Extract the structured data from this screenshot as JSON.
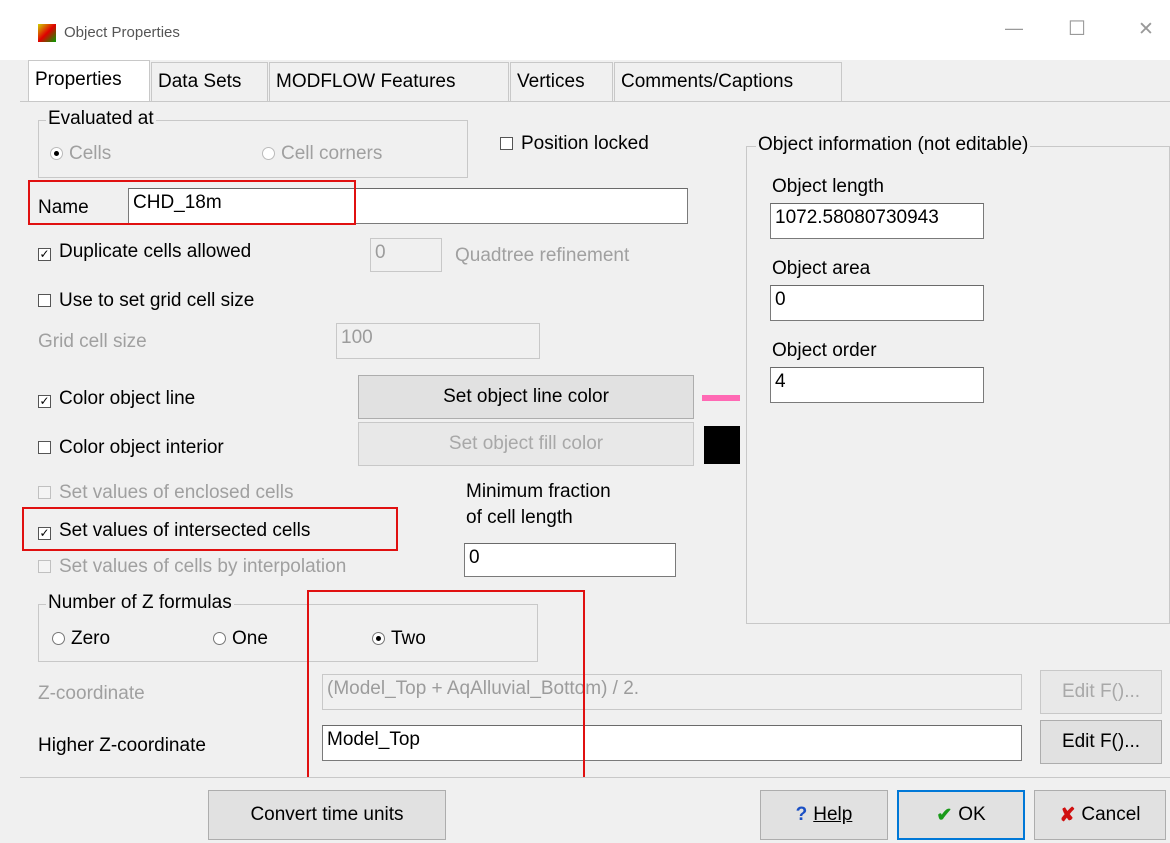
{
  "window": {
    "title": "Object Properties",
    "controls": {
      "minimize": "—",
      "maximize": "☐",
      "close": "✕"
    }
  },
  "tabs": [
    {
      "label": "Properties",
      "active": true
    },
    {
      "label": "Data Sets"
    },
    {
      "label": "MODFLOW Features"
    },
    {
      "label": "Vertices"
    },
    {
      "label": "Comments/Captions"
    }
  ],
  "evaluated_at": {
    "legend": "Evaluated at",
    "cells": "Cells",
    "cell_corners": "Cell corners",
    "selected": "cells"
  },
  "position_locked": {
    "label": "Position locked",
    "checked": false
  },
  "name": {
    "label": "Name",
    "value": "CHD_18m"
  },
  "duplicate_cells": {
    "label": "Duplicate cells allowed",
    "checked": true
  },
  "quadtree": {
    "value": "0",
    "label": "Quadtree refinement"
  },
  "grid_size": {
    "checkbox_label": "Use to set grid cell size",
    "label": "Grid cell size",
    "value": "100"
  },
  "color_line": {
    "label": "Color object line",
    "checked": true,
    "button": "Set object line color",
    "swatch": "#ff69b4"
  },
  "color_interior": {
    "label": "Color object interior",
    "checked": false,
    "button": "Set object fill color",
    "swatch": "#000000"
  },
  "enclosed": {
    "label": "Set values of enclosed cells"
  },
  "intersected": {
    "label": "Set values of intersected cells",
    "checked": true
  },
  "interpolation": {
    "label": "Set values of cells by interpolation"
  },
  "min_fraction": {
    "line1": "Minimum fraction",
    "line2": "of cell length",
    "value": "0"
  },
  "z_formulas": {
    "legend": "Number of Z formulas",
    "zero": "Zero",
    "one": "One",
    "two": "Two",
    "selected": "two"
  },
  "z_coord": {
    "label": "Z-coordinate",
    "value": "(Model_Top + AqAlluvial_Bottom) / 2.",
    "button": "Edit F()..."
  },
  "higher_z": {
    "label": "Higher Z-coordinate",
    "value": "Model_Top",
    "button": "Edit F()..."
  },
  "object_info": {
    "legend": "Object information (not editable)",
    "length_label": "Object length",
    "length_value": "1072.58080730943",
    "area_label": "Object area",
    "area_value": "0",
    "order_label": "Object order",
    "order_value": "4"
  },
  "footer": {
    "convert": "Convert time units",
    "help_icon": "?",
    "help": "Help",
    "ok_icon": "✔",
    "ok": "OK",
    "cancel_icon": "✘",
    "cancel": "Cancel"
  }
}
